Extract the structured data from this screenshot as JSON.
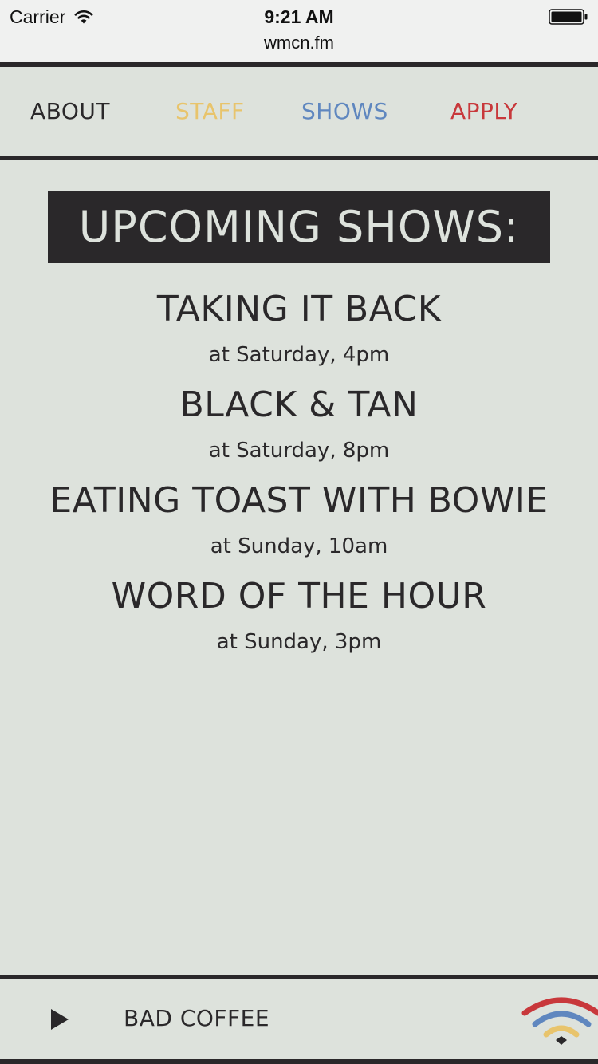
{
  "status_bar": {
    "carrier": "Carrier",
    "time": "9:21 AM",
    "wifi_icon": "wifi-icon",
    "battery_icon": "battery-icon"
  },
  "browser": {
    "url": "wmcn.fm"
  },
  "nav": {
    "items": [
      {
        "label": "ABOUT",
        "color": "#2a282a"
      },
      {
        "label": "STAFF",
        "color": "#e8c46c"
      },
      {
        "label": "SHOWS",
        "color": "#5f87bf"
      },
      {
        "label": "APPLY",
        "color": "#c8383b"
      }
    ]
  },
  "page": {
    "title": "UPCOMING SHOWS:"
  },
  "shows": [
    {
      "title": "TAKING IT BACK",
      "time": "at Saturday, 4pm"
    },
    {
      "title": "BLACK & TAN",
      "time": "at Saturday, 8pm"
    },
    {
      "title": "EATING TOAST WITH BOWIE",
      "time": "at Sunday, 10am"
    },
    {
      "title": "WORD OF THE HOUR",
      "time": "at Sunday, 3pm"
    }
  ],
  "player": {
    "play_icon": "play-icon",
    "track": "BAD COFFEE",
    "logo_icon": "radio-signal-logo-icon"
  },
  "colors": {
    "background": "#dde2dc",
    "dark": "#2a282a",
    "yellow": "#e8c46c",
    "blue": "#5f87bf",
    "red": "#c8383b"
  }
}
